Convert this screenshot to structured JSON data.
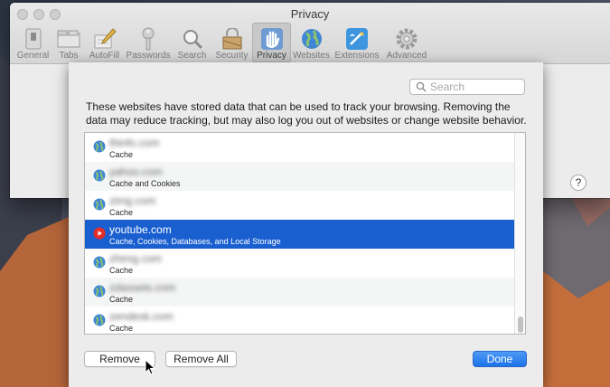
{
  "window": {
    "title": "Privacy",
    "toolbar": [
      {
        "label": "General",
        "icon": "general-switch-icon"
      },
      {
        "label": "Tabs",
        "icon": "tabs-icon"
      },
      {
        "label": "AutoFill",
        "icon": "autofill-pencil-icon"
      },
      {
        "label": "Passwords",
        "icon": "key-icon"
      },
      {
        "label": "Search",
        "icon": "magnifier-icon"
      },
      {
        "label": "Security",
        "icon": "padlock-icon"
      },
      {
        "label": "Privacy",
        "icon": "hand-icon",
        "active": true
      },
      {
        "label": "Websites",
        "icon": "globe-icon"
      },
      {
        "label": "Extensions",
        "icon": "puzzle-icon"
      },
      {
        "label": "Advanced",
        "icon": "gear-icon"
      }
    ],
    "help_label": "?"
  },
  "sheet": {
    "search_placeholder": "Search",
    "description": "These websites have stored data that can be used to track your browsing. Removing the data may reduce tracking, but may also log you out of websites or change website behavior.",
    "sites": [
      {
        "domain": "thinfo.com",
        "detail": "Cache",
        "icon": "globe-icon"
      },
      {
        "domain": "yahoo.com",
        "detail": "Cache and Cookies",
        "icon": "globe-icon"
      },
      {
        "domain": "zimg.com",
        "detail": "Cache",
        "icon": "globe-icon"
      },
      {
        "domain": "youtube.com",
        "detail": "Cache, Cookies, Databases, and Local Storage",
        "icon": "youtube-icon",
        "selected": true
      },
      {
        "domain": "zhimg.com",
        "detail": "Cache",
        "icon": "globe-icon"
      },
      {
        "domain": "zdassets.com",
        "detail": "Cache",
        "icon": "globe-icon"
      },
      {
        "domain": "zendesk.com",
        "detail": "Cache",
        "icon": "globe-icon"
      }
    ],
    "buttons": {
      "remove": "Remove",
      "remove_all": "Remove All",
      "done": "Done"
    }
  },
  "colors": {
    "selection": "#1a5fd0",
    "primary_button": "#1c72e8"
  }
}
